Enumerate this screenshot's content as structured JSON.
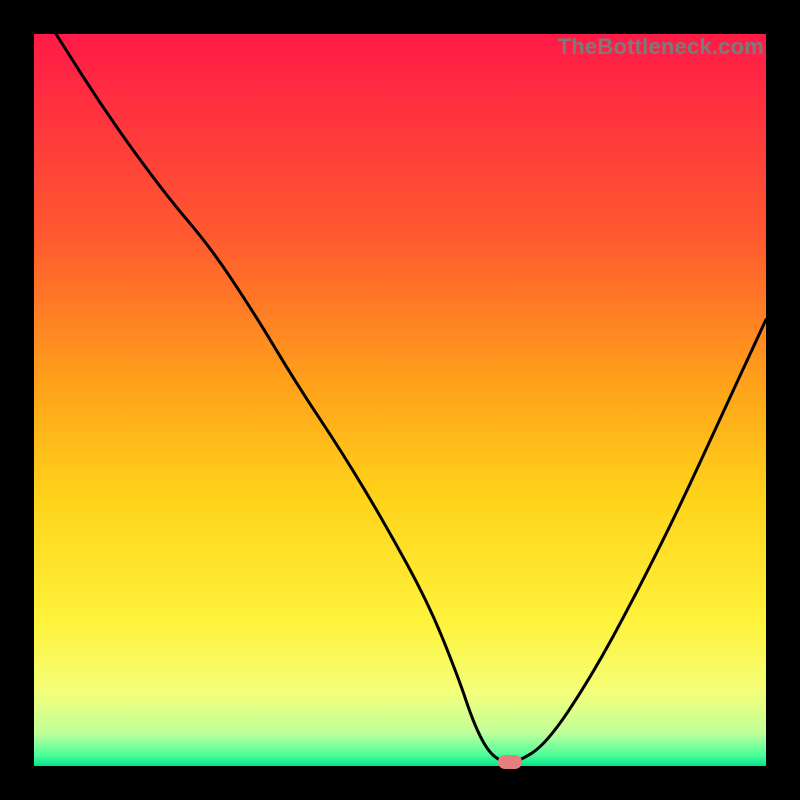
{
  "watermark": "TheBottleneck.com",
  "chart_data": {
    "type": "line",
    "title": "",
    "xlabel": "",
    "ylabel": "",
    "xlim": [
      0,
      100
    ],
    "ylim": [
      0,
      100
    ],
    "grid": false,
    "series": [
      {
        "name": "curve",
        "color": "#000000",
        "x": [
          3,
          10,
          18,
          24,
          30,
          36,
          42,
          48,
          54,
          58,
          60,
          62,
          64,
          66,
          70,
          76,
          82,
          88,
          94,
          100
        ],
        "y": [
          100,
          89,
          78,
          71,
          62,
          52,
          43,
          33,
          22,
          12,
          6,
          2,
          0.5,
          0.5,
          3,
          12,
          23,
          35,
          48,
          61
        ]
      }
    ],
    "marker": {
      "x": 65,
      "y": 0.5,
      "color": "#e68080"
    },
    "gradient_stops": [
      {
        "offset": 0.0,
        "color": "#ff1a47"
      },
      {
        "offset": 0.28,
        "color": "#ff5a2f"
      },
      {
        "offset": 0.48,
        "color": "#ffa21a"
      },
      {
        "offset": 0.63,
        "color": "#ffd21a"
      },
      {
        "offset": 0.8,
        "color": "#fff23a"
      },
      {
        "offset": 0.9,
        "color": "#f4ff7a"
      },
      {
        "offset": 0.955,
        "color": "#bfff9a"
      },
      {
        "offset": 0.985,
        "color": "#4dff9a"
      },
      {
        "offset": 1.0,
        "color": "#00e58a"
      }
    ]
  }
}
